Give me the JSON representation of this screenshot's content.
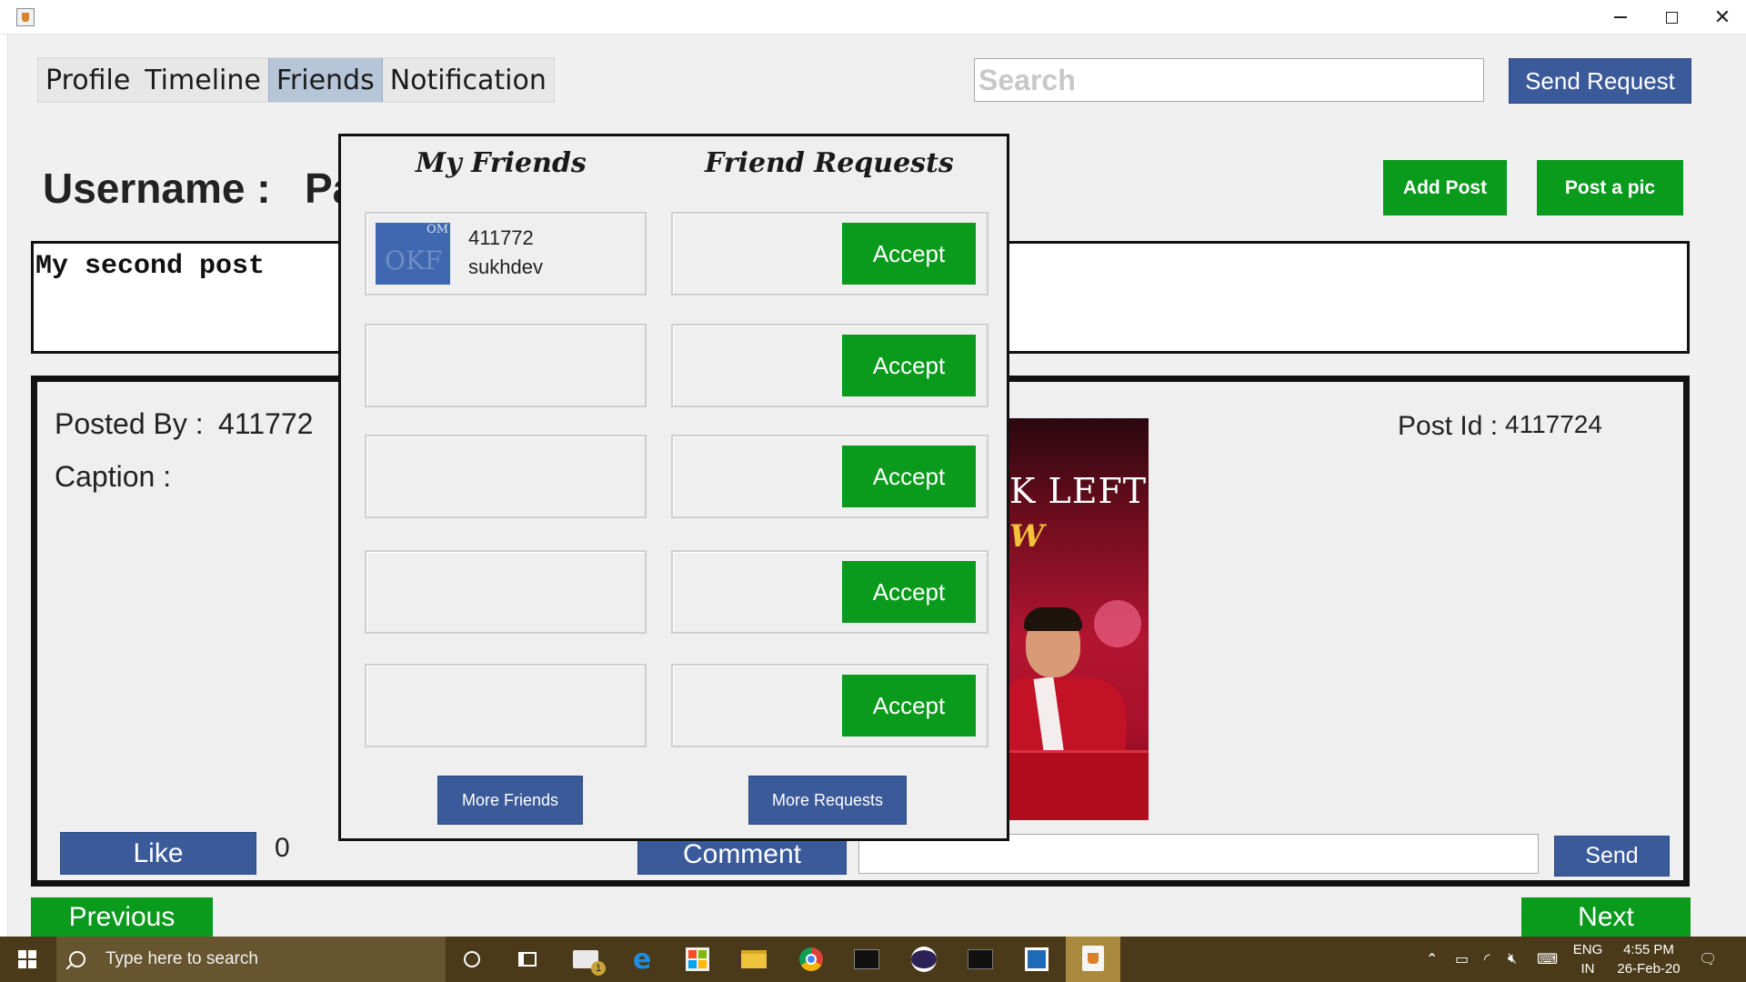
{
  "window": {
    "minimize_icon": "minimize-icon",
    "maximize_icon": "maximize-icon",
    "close_icon": "close-icon",
    "close_glyph": "✕"
  },
  "tabs": [
    {
      "label": "Profile",
      "active": false
    },
    {
      "label": "Timeline",
      "active": false
    },
    {
      "label": "Friends",
      "active": true
    },
    {
      "label": "Notification",
      "active": false
    }
  ],
  "search": {
    "placeholder": "Search",
    "value": ""
  },
  "buttons": {
    "send_request": "Send Request",
    "add_post": "Add Post",
    "post_pic": "Post a pic",
    "like": "Like",
    "comment": "Comment",
    "send": "Send",
    "previous": "Previous",
    "next": "Next"
  },
  "profile": {
    "username_label": "Username :",
    "username_value_partial": "Pa"
  },
  "post_input": {
    "text": "My second post"
  },
  "post": {
    "posted_by_label": "Posted By :",
    "posted_by_value": "411772",
    "caption_label": "Caption :",
    "post_id_label": "Post Id :",
    "post_id_value": "4117724",
    "like_count": "0",
    "image_text_line1": "K LEFT",
    "image_text_line2": "W"
  },
  "friends_popup": {
    "my_friends_title": "My Friends",
    "friend_requests_title": "Friend Requests",
    "friends": [
      {
        "id": "411772",
        "name": "sukhdev",
        "thumb_text": "OM",
        "thumb_overlay": "OKF"
      },
      {
        "id": "",
        "name": ""
      },
      {
        "id": "",
        "name": ""
      },
      {
        "id": "",
        "name": ""
      },
      {
        "id": "",
        "name": ""
      }
    ],
    "accept_label": "Accept",
    "more_friends": "More Friends",
    "more_requests": "More Requests"
  },
  "taskbar": {
    "search_placeholder": "Type here to search",
    "mail_badge": "1",
    "language_line1": "ENG",
    "language_line2": "IN",
    "time": "4:55 PM",
    "date": "26-Feb-20"
  },
  "colors": {
    "tab_active": "#b6c6d8",
    "blue_button": "#3a5a9a",
    "green_button": "#0a9a1c",
    "taskbar": "#4b3a1a"
  }
}
